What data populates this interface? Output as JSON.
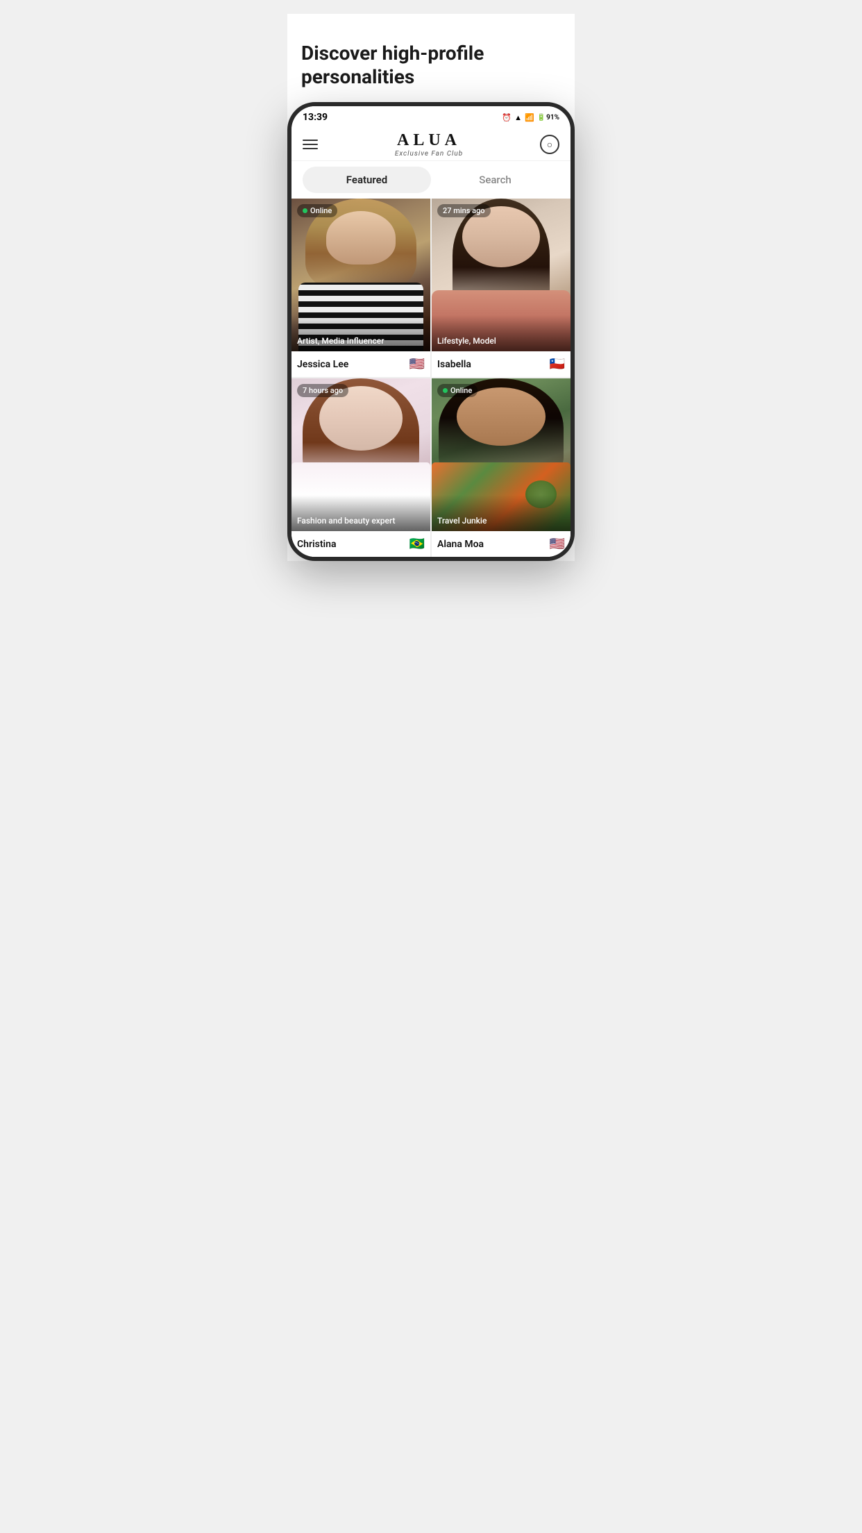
{
  "page": {
    "title": "Discover high-profile personalities"
  },
  "status_bar": {
    "time": "13:39",
    "battery": "91%",
    "icons": [
      "alarm",
      "wifi",
      "signal",
      "battery"
    ]
  },
  "app": {
    "name": "ALUA",
    "subtitle": "Exclusive Fan Club",
    "menu_icon": "hamburger",
    "chat_icon": "chat-bubble"
  },
  "tabs": [
    {
      "id": "featured",
      "label": "Featured",
      "active": true
    },
    {
      "id": "search",
      "label": "Search",
      "active": false
    }
  ],
  "cards": [
    {
      "id": 1,
      "name": "Jessica Lee",
      "category": "Artist, Media Influencer",
      "flag": "🇺🇸",
      "status": "Online",
      "status_type": "online",
      "color_top": "#8B7355",
      "color_mid": "#7B6045",
      "color_bottom": "#4A3020"
    },
    {
      "id": 2,
      "name": "Isabella",
      "category": "Lifestyle, Model",
      "flag": "🇨🇱",
      "status": "27 mins ago",
      "status_type": "time",
      "color_top": "#C4B0A0",
      "color_mid": "#D4C0B0",
      "color_bottom": "#8B7060"
    },
    {
      "id": 3,
      "name": "Christina",
      "category": "Fashion and beauty expert",
      "flag": "🇧🇷",
      "status": "7 hours ago",
      "status_type": "time",
      "color_top": "#D4B8C0",
      "color_mid": "#E0C8D0",
      "color_bottom": "#F5F0F0"
    },
    {
      "id": 4,
      "name": "Alana Moa",
      "category": "Travel Junkie",
      "flag": "🇺🇸",
      "status": "Online",
      "status_type": "online",
      "color_top": "#4A7A50",
      "color_mid": "#5A8A55",
      "color_bottom": "#3A5530"
    }
  ]
}
